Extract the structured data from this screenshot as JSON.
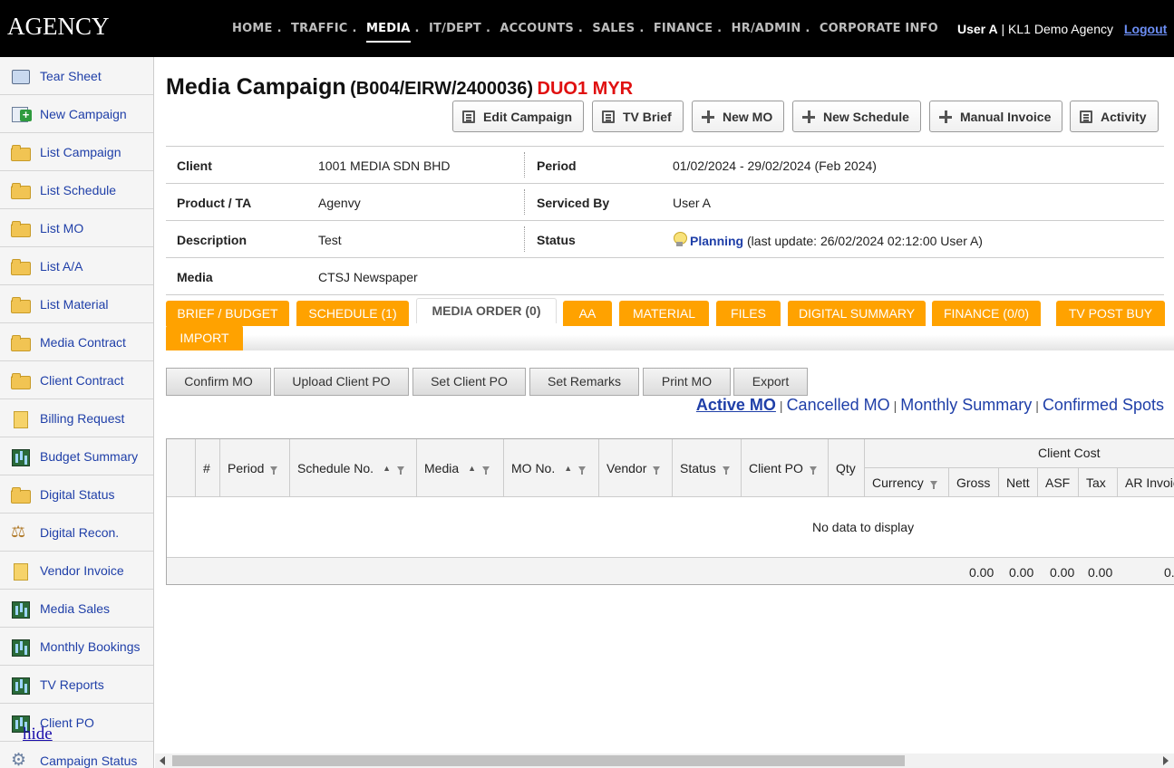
{
  "header": {
    "logo": "AGENCY",
    "nav": [
      {
        "label": "HOME",
        "active": false
      },
      {
        "label": "TRAFFIC",
        "active": false
      },
      {
        "label": "MEDIA",
        "active": true
      },
      {
        "label": "IT/DEPT",
        "active": false
      },
      {
        "label": "ACCOUNTS",
        "active": false
      },
      {
        "label": "SALES",
        "active": false
      },
      {
        "label": "FINANCE",
        "active": false
      },
      {
        "label": "HR/ADMIN",
        "active": false
      },
      {
        "label": "CORPORATE INFO",
        "active": false
      }
    ],
    "nav_separator": ".",
    "user": "User A",
    "user_sep": " | ",
    "agency": "KL1 Demo Agency",
    "logout": "Logout"
  },
  "sidebar": {
    "items": [
      {
        "label": "Tear Sheet",
        "icon": "tear-sheet-icon"
      },
      {
        "label": "New Campaign",
        "icon": "new-campaign-icon"
      },
      {
        "label": "List Campaign",
        "icon": "folder-icon"
      },
      {
        "label": "List Schedule",
        "icon": "folder-icon"
      },
      {
        "label": "List MO",
        "icon": "folder-icon"
      },
      {
        "label": "List A/A",
        "icon": "folder-icon"
      },
      {
        "label": "List Material",
        "icon": "folder-icon"
      },
      {
        "label": "Media Contract",
        "icon": "folder-icon"
      },
      {
        "label": "Client Contract",
        "icon": "folder-icon"
      },
      {
        "label": "Billing Request",
        "icon": "document-icon"
      },
      {
        "label": "Budget Summary",
        "icon": "chart-icon"
      },
      {
        "label": "Digital Status",
        "icon": "folder-icon"
      },
      {
        "label": "Digital Recon.",
        "icon": "scale-icon"
      },
      {
        "label": "Vendor Invoice",
        "icon": "document-icon"
      },
      {
        "label": "Media Sales",
        "icon": "chart-icon"
      },
      {
        "label": "Monthly Bookings",
        "icon": "chart-icon"
      },
      {
        "label": "TV Reports",
        "icon": "chart-icon"
      },
      {
        "label": "Client PO",
        "icon": "chart-icon"
      },
      {
        "label": "Campaign Status",
        "icon": "gear-icon"
      }
    ],
    "hide_label": "hide"
  },
  "page": {
    "title": "Media Campaign",
    "code": "(B004/EIRW/2400036)",
    "code_suffix": "DUO1 MYR",
    "accent_color": "#e01010"
  },
  "actions": [
    {
      "label": "Edit Campaign",
      "icon": "list-icon"
    },
    {
      "label": "TV Brief",
      "icon": "list-icon"
    },
    {
      "label": "New MO",
      "icon": "plus-icon"
    },
    {
      "label": "New Schedule",
      "icon": "plus-icon"
    },
    {
      "label": "Manual Invoice",
      "icon": "plus-icon"
    },
    {
      "label": "Activity",
      "icon": "list-icon"
    }
  ],
  "info": {
    "client_label": "Client",
    "client_value": "1001 MEDIA SDN BHD",
    "period_label": "Period",
    "period_value": "01/02/2024 - 29/02/2024 (Feb 2024)",
    "product_label": "Product / TA",
    "product_value": "Agenvy",
    "serviced_label": "Serviced By",
    "serviced_value": "User A",
    "description_label": "Description",
    "description_value": "Test",
    "status_label": "Status",
    "status_value": "Planning",
    "status_detail": "(last update: 26/02/2024 02:12:00 User A)",
    "media_label": "Media",
    "media_value": "CTSJ Newspaper"
  },
  "tabs": [
    {
      "label": "BRIEF / BUDGET",
      "active": false
    },
    {
      "label": "SCHEDULE (1)",
      "active": false
    },
    {
      "label": "MEDIA ORDER (0)",
      "active": true
    },
    {
      "label": "AA",
      "active": false
    },
    {
      "label": "MATERIAL",
      "active": false
    },
    {
      "label": "FILES",
      "active": false
    },
    {
      "label": "DIGITAL SUMMARY",
      "active": false
    },
    {
      "label": "FINANCE (0/0)",
      "active": false
    },
    {
      "label": "TV POST BUY",
      "active": false
    },
    {
      "label": "IMPORT",
      "active": false
    }
  ],
  "tab_color": "#ffa200",
  "toolbar": {
    "buttons": [
      "Confirm MO",
      "Upload Client PO",
      "Set Client PO",
      "Set Remarks",
      "Print MO",
      "Export"
    ]
  },
  "views": {
    "items": [
      "Active MO",
      "Cancelled MO",
      "Monthly Summary",
      "Confirmed Spots"
    ],
    "active": "Active MO",
    "separator": "|"
  },
  "grid": {
    "columns": [
      "#",
      "Period",
      "Schedule No.",
      "Media",
      "MO No.",
      "Vendor",
      "Status",
      "Client PO",
      "Qty"
    ],
    "group_label": "Client Cost",
    "sub_columns": [
      "Currency",
      "Gross",
      "Nett",
      "ASF",
      "Tax",
      "AR Invoic"
    ],
    "empty_text": "No data to display",
    "totals": [
      "0.00",
      "0.00",
      "0.00",
      "0.00",
      "0."
    ]
  }
}
